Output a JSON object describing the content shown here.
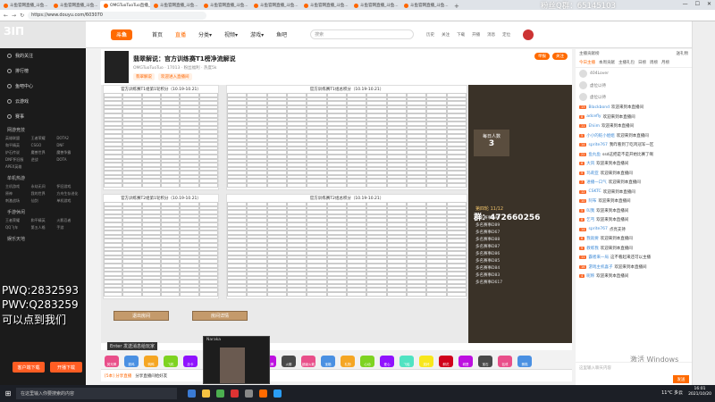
{
  "browser": {
    "tabs": [
      "斗鱼官网直播_斗鱼...",
      "斗鱼官网直播_斗鱼...",
      "OMGTuoTuoTuo直播_斗鱼...",
      "斗鱼官网直播_斗鱼...",
      "斗鱼官网直播_斗鱼...",
      "斗鱼官网直播_斗鱼...",
      "斗鱼官网直播_斗鱼...",
      "斗鱼官网直播_斗鱼...",
      "斗鱼官网直播_斗鱼..."
    ],
    "url": "https://www.douyu.com/603070",
    "watermark": "粉丝Q群：65145103"
  },
  "webcam": {
    "text": "ЗIП"
  },
  "sidebar": {
    "items": [
      "我的关注",
      "排行榜",
      "鱼吧中心",
      "云游戏",
      "赛事"
    ],
    "sections": [
      {
        "title": "网游竞技",
        "tags": [
          "英雄联盟",
          "王者荣耀",
          "DOTA2",
          "和平精英",
          "CSGO",
          "DNF",
          "炉石传说",
          "魔兽世界",
          "魔兽争霸",
          "DNF怀旧服",
          "逆战",
          "DOTA",
          "APEX英雄"
        ]
      },
      {
        "title": "单机热游",
        "tags": [
          "主机游戏",
          "永劫无间",
          "怀旧游戏",
          "原神",
          "我的世界",
          "方舟生存进化",
          "刺激战场",
          "仙剑",
          "单机游戏"
        ]
      },
      {
        "title": "手游休闲",
        "tags": [
          "王者荣耀",
          "和平精英",
          "火影忍者",
          "QQ飞车",
          "第五人格",
          "手游"
        ]
      },
      {
        "title": "娱乐天地",
        "tags": []
      }
    ],
    "btn_left": "客户端下载",
    "btn_right": "开播下载"
  },
  "overlay": {
    "pwq": "PWQ:2832593",
    "pwv": "PWV:Q283259",
    "note": "可以点到我们"
  },
  "topnav": {
    "logo": "斗鱼",
    "links": [
      "首页",
      "直播",
      "分类▾",
      "视频▾",
      "游戏▾",
      "鱼吧"
    ],
    "search_placeholder": "搜索",
    "icons": [
      "历史",
      "关注",
      "下载",
      "开播",
      "消息",
      "定位"
    ]
  },
  "room": {
    "title": "翡翠解说：官方训练赛T1榜净流解说",
    "meta": [
      "OMGTuoTuoTuo",
      "17013",
      "粉丝福利",
      "热度5k"
    ],
    "badges": [
      "翡翠解说",
      "欢迎进入直播间"
    ],
    "follow": "关注",
    "report": "举报"
  },
  "sheets": [
    {
      "title": "官方训练赛T1组第1轮积分（10.19-10.21）"
    },
    {
      "title": "官方训练赛T1组总积分（10.19-10.21）"
    },
    {
      "title": "官方训练赛T2组第1轮积分（10.19-10.21）"
    },
    {
      "title": "官方训练赛T2组总积分（10.19-10.21）"
    }
  ],
  "stream": {
    "count_label": "每日人数",
    "count_value": "3",
    "round": "第四轮 11/12",
    "lines": [
      "多名赛事D90",
      "多名赛事D89",
      "多名赛事D67",
      "多名赛事D88",
      "多名赛事D87",
      "多名赛事D86",
      "多名赛事D85",
      "多名赛事D84",
      "多名赛事D83",
      "多名赛事D617"
    ],
    "qun": "群：472660256",
    "btn_exit": "退出房间",
    "btn_detail": "房间详情",
    "hint": "Enter 发送消息给玩家"
  },
  "thumb": {
    "title": "Naraka"
  },
  "gifts": [
    "荧光棒",
    "弱鸡",
    "鸭鸭",
    "飞机",
    "办卡",
    "小星星",
    "666",
    "大佬",
    "魔法棒",
    "火箭",
    "超级火箭",
    "宝箱",
    "礼物",
    "心动",
    "爱心",
    "飞船",
    "奖杯",
    "鲜花",
    "城堡",
    "宝石",
    "钻戒",
    "蛋糕"
  ],
  "footer": {
    "label": "[5本] 分享直播",
    "text": "分享直播间给好友"
  },
  "chat": {
    "tabs": [
      "今日主播",
      "本周贡献",
      "主播礼包",
      "日榜",
      "周榜",
      "月榜"
    ],
    "lad_header": "主播贡献榜",
    "lad_right": "送礼物",
    "ladder": [
      "404Lover",
      "虚位以待",
      "虚位以待"
    ],
    "messages": [
      {
        "lv": "13",
        "name": "Blackbond",
        "text": "欢迎来到本直播间"
      },
      {
        "lv": "8",
        "name": "adcefly",
        "text": "欢迎来到本直播间"
      },
      {
        "lv": "11",
        "name": "Ehiim",
        "text": "欢迎来到本直播间"
      },
      {
        "lv": "5",
        "name": "小小的蛇小姐姐",
        "text": "欢迎来到本直播间"
      },
      {
        "lv": "14",
        "name": "sprite767",
        "text": "我咋看到了吃鸡冠军一区"
      },
      {
        "lv": "22",
        "name": "鱼丸鱼",
        "text": "ssd这把是不是开始比赛了啊"
      },
      {
        "lv": "6",
        "name": "大风",
        "text": "欢迎来到本直播间"
      },
      {
        "lv": "9",
        "name": "玛莉亚",
        "text": "欢迎来到本直播间"
      },
      {
        "lv": "7",
        "name": "进播一口气",
        "text": "欢迎来到本直播间"
      },
      {
        "lv": "12",
        "name": "CSKTC",
        "text": "欢迎来到本直播间"
      },
      {
        "lv": "10",
        "name": "阿布",
        "text": "欢迎来到本直播间"
      },
      {
        "lv": "5",
        "name": "叫我",
        "text": "欢迎来到本直播间"
      },
      {
        "lv": "8",
        "name": "乞丐",
        "text": "欢迎来到本直播间"
      },
      {
        "lv": "14",
        "name": "sprite767",
        "text": "点亮支持"
      },
      {
        "lv": "6",
        "name": "我就要",
        "text": "欢迎来到本直播间"
      },
      {
        "lv": "9",
        "name": "教练我",
        "text": "欢迎来到本直播间"
      },
      {
        "lv": "11",
        "name": "霸者来一局",
        "text": "这不看起来还可以主播"
      },
      {
        "lv": "16",
        "name": "游戏主机喜子",
        "text": "欢迎来到本直播间"
      },
      {
        "lv": "4",
        "name": "昵称",
        "text": "欢迎来到本直播间"
      }
    ],
    "placeholder": "这里输入聊天内容",
    "send": "发送"
  },
  "windows": {
    "activate": "激活 Windows"
  },
  "taskbar": {
    "search_placeholder": "在这里输入你要搜索的内容",
    "temp": "11°C 多云",
    "time": "16:01",
    "date": "2021/10/20"
  },
  "colors": {
    "accent": "#ff6a00",
    "sidebar": "#1b1b1b"
  }
}
